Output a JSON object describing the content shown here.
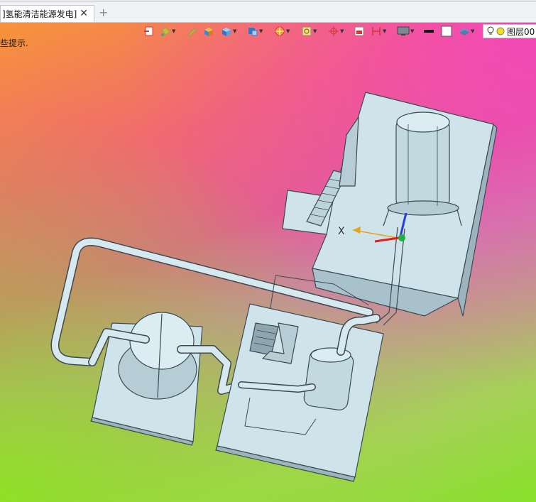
{
  "document_tab": {
    "title": "]氢能清洁能源发电]",
    "close": "✕"
  },
  "new_tab": "+",
  "hint_text": "些提示.",
  "layer_selector": {
    "value": "图层00"
  },
  "axis_label": "X",
  "toolbar": {
    "icons": [
      "import-icon",
      "paint-bucket-icon",
      "pencil-icon",
      "solid-box-icon",
      "shaded-cube-icon",
      "view-cube-icon",
      "render-sphere-icon",
      "zoom-fit-icon",
      "axis-target-icon",
      "section-view-icon",
      "dimension-icon",
      "monitor-icon",
      "line-color-icon",
      "fill-color-icon",
      "layers-icon"
    ]
  },
  "colors": {
    "model_light": "#cfe6ee",
    "model_edge": "#3c4a52",
    "platform": "#cfe3ea"
  }
}
